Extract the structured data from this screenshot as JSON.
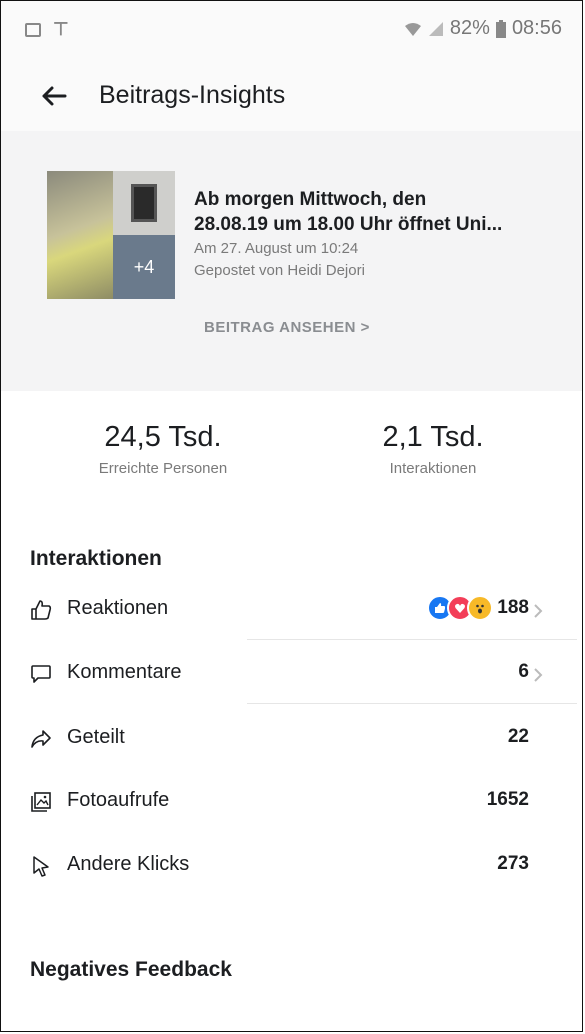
{
  "status_bar": {
    "battery": "82%",
    "time": "08:56"
  },
  "header": {
    "title": "Beitrags-Insights"
  },
  "post": {
    "title_line1": "Ab morgen Mittwoch, den",
    "title_line2": "28.08.19 um 18.00 Uhr öffnet Uni...",
    "date": "Am 27. August um 10:24",
    "posted_by": "Gepostet von Heidi Dejori",
    "more_photos": "+4",
    "view_label": "BEITRAG ANSEHEN >"
  },
  "stats": [
    {
      "value": "24,5 Tsd.",
      "label": "Erreichte Personen"
    },
    {
      "value": "2,1 Tsd.",
      "label": "Interaktionen"
    }
  ],
  "interactions": {
    "title": "Interaktionen",
    "rows": [
      {
        "label": "Reaktionen",
        "count": "188",
        "icon": "thumbs-up-icon"
      },
      {
        "label": "Kommentare",
        "count": "6",
        "icon": "comment-icon"
      },
      {
        "label": "Geteilt",
        "count": "22",
        "icon": "share-icon"
      },
      {
        "label": "Fotoaufrufe",
        "count": "1652",
        "icon": "photo-icon"
      },
      {
        "label": "Andere Klicks",
        "count": "273",
        "icon": "cursor-icon"
      }
    ]
  },
  "negative": {
    "title": "Negatives Feedback"
  },
  "colors": {
    "like_blue": "#1877f2",
    "love_red": "#f33e58",
    "wow_yellow": "#f7b928"
  }
}
